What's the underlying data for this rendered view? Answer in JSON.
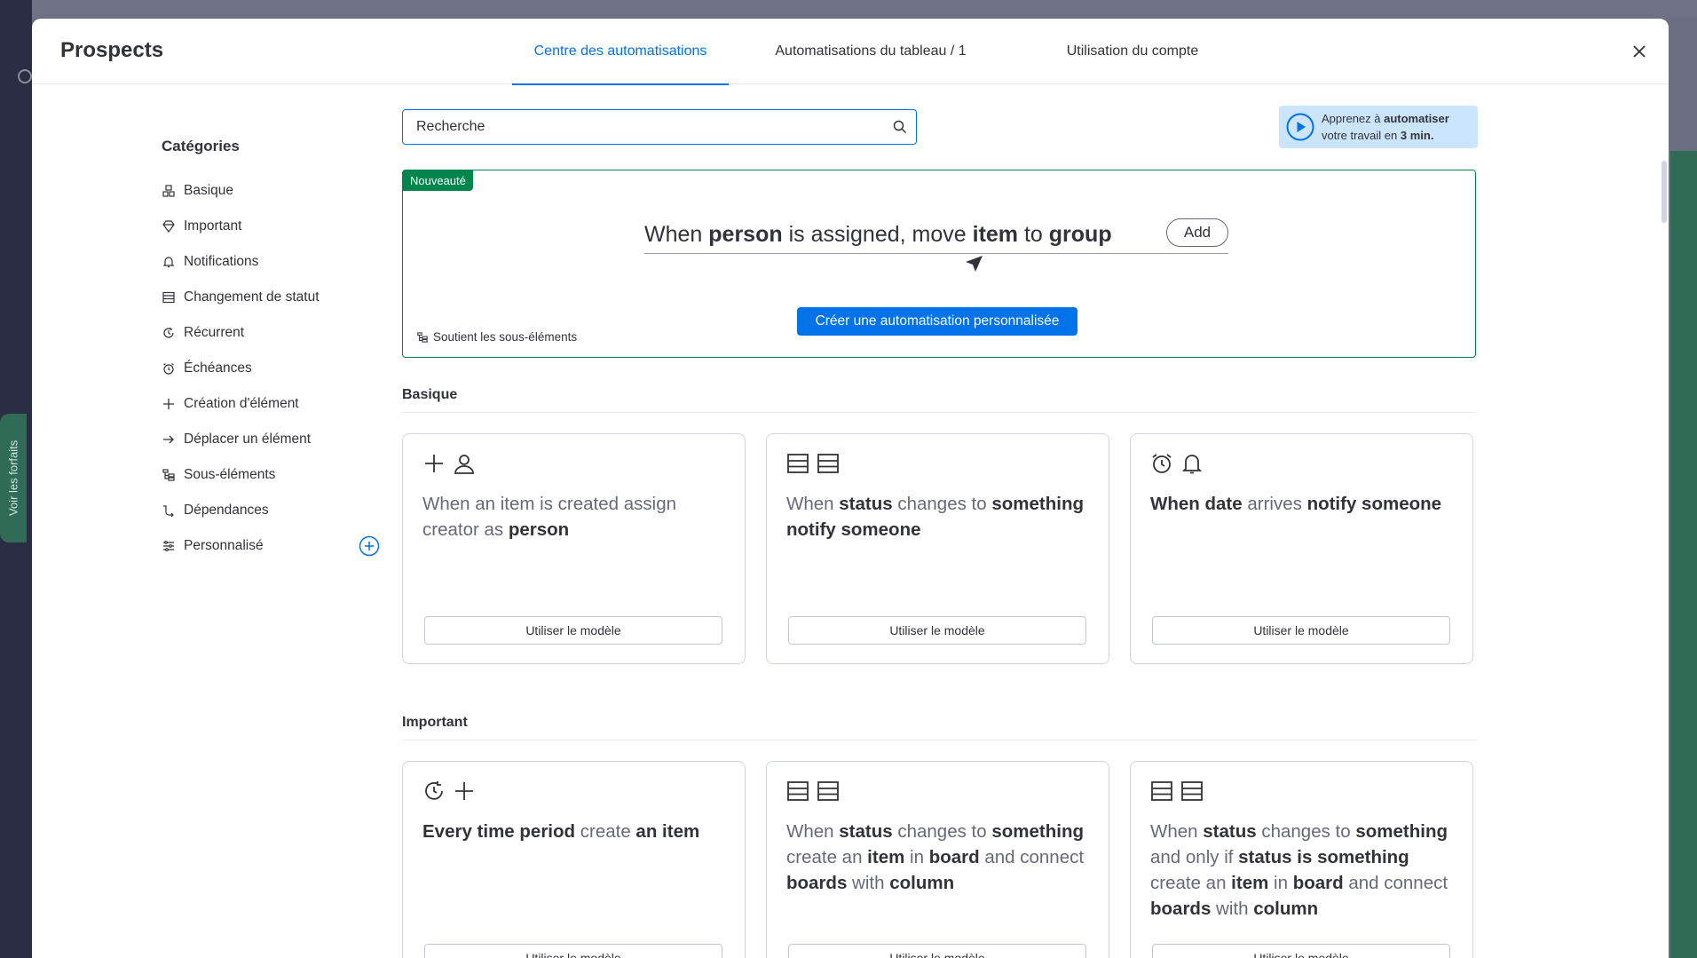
{
  "header": {
    "title": "Prospects",
    "tabs": [
      {
        "label": "Centre des automatisations"
      },
      {
        "label": "Automatisations du tableau  / 1"
      },
      {
        "label": "Utilisation du compte"
      }
    ]
  },
  "background": {
    "badge": "Voir les forfaits"
  },
  "sidebar": {
    "title": "Catégories",
    "items": [
      {
        "label": "Basique",
        "icon": "basic-icon"
      },
      {
        "label": "Important",
        "icon": "diamond-icon"
      },
      {
        "label": "Notifications",
        "icon": "bell-icon"
      },
      {
        "label": "Changement de statut",
        "icon": "status-icon"
      },
      {
        "label": "Récurrent",
        "icon": "recurring-icon"
      },
      {
        "label": "Échéances",
        "icon": "alarm-icon"
      },
      {
        "label": "Création d'élément",
        "icon": "plus-icon"
      },
      {
        "label": "Déplacer un élément",
        "icon": "arrow-right-icon"
      },
      {
        "label": "Sous-éléments",
        "icon": "subitems-icon"
      },
      {
        "label": "Dépendances",
        "icon": "dependency-icon"
      },
      {
        "label": "Personnalisé",
        "icon": "sliders-icon"
      }
    ]
  },
  "search": {
    "placeholder": "Recherche"
  },
  "learn": {
    "line1_pre": "Apprenez à ",
    "line1_bold": "automatiser",
    "line2_pre": "votre travail en ",
    "line2_bold": "3 min."
  },
  "custom": {
    "badge": "Nouveauté",
    "s1": "When ",
    "s2": "person",
    "s3": " is assigned, move ",
    "s4": "item",
    "s5": " to ",
    "s6": "group",
    "add_label": "Add",
    "create_label": "Créer une automatisation personnalisée",
    "subitems_note": "Soutient les sous-éléments"
  },
  "sections": {
    "basic": "Basique",
    "important": "Important"
  },
  "use_template_label": "Utiliser le modèle",
  "cards": {
    "c1": {
      "p1": "When an item is created assign creator as ",
      "p2": "person"
    },
    "c2": {
      "p1": "When ",
      "p2": "status",
      "p3": " changes to ",
      "p4": "something",
      "p5": " ",
      "p6": "notify someone"
    },
    "c3": {
      "p1": "When date",
      "p2": " arrives ",
      "p3": "notify someone"
    },
    "c4": {
      "p1": "Every time period",
      "p2": " create ",
      "p3": "an item"
    },
    "c5": {
      "p1": "When ",
      "p2": "status",
      "p3": " changes to ",
      "p4": "something",
      "p5": " create an ",
      "p6": "item",
      "p7": " in ",
      "p8": "board",
      "p9": " and connect ",
      "p10": "boards",
      "p11": " with ",
      "p12": "column"
    },
    "c6": {
      "p1": "When ",
      "p2": "status",
      "p3": " changes to ",
      "p4": "something",
      "p5": " and only if ",
      "p6": "status",
      "p7": " ",
      "p8": "is",
      "p9": " ",
      "p10": "something",
      "p11": " create an ",
      "p12": "item",
      "p13": " in ",
      "p14": "board",
      "p15": " and connect ",
      "p16": "boards",
      "p17": " with ",
      "p18": "column"
    }
  },
  "colors": {
    "accent": "#0073ea",
    "new_green": "#00854d"
  }
}
